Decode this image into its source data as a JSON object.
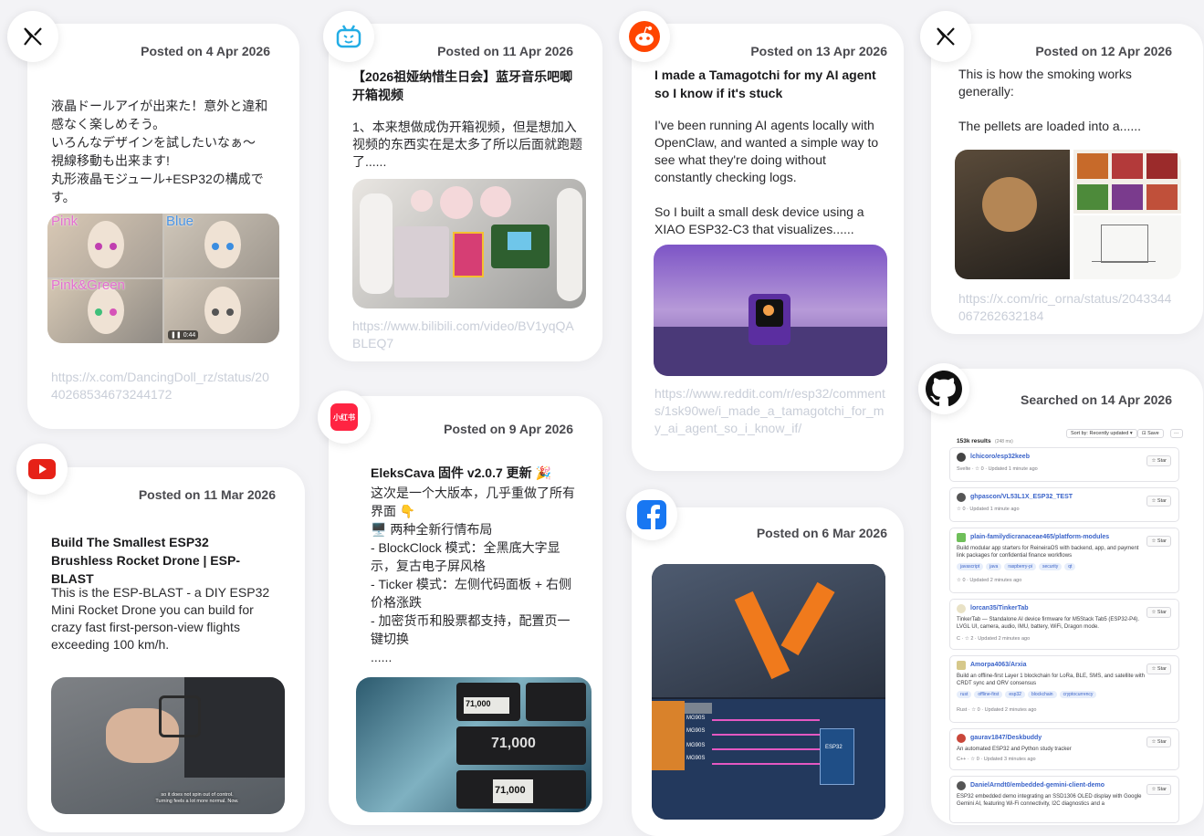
{
  "cards": [
    {
      "source": "x-icon",
      "posted": "Posted on 4 Apr 2026",
      "body": "液晶ドールアイが出来た！意外と違和\n感なく楽しめそう。\nいろんなデザインを試したいなぁ～\n視線移動も出来ます!\n丸形液晶モジュール+ESP32の構成で\nす。",
      "media_labels": [
        "Pink",
        "Blue",
        "Pink&Green"
      ],
      "media_duration": "0:44",
      "link": "https://x.com/DancingDoll_rz/status/2040268534673244172"
    },
    {
      "source": "youtube-icon",
      "posted": "Posted on 11 Mar 2026",
      "title": "Build The Smallest ESP32 Brushless Rocket Drone | ESP-BLAST",
      "body": "This is the ESP-BLAST - a DIY ESP32\nMini Rocket Drone you can build for\ncrazy fast first-person-view flights\nexceeding 100 km/h.",
      "media_caption": "so it does not spin out of control.\nTurning feels a lot more normal. Now."
    },
    {
      "source": "bilibili-icon",
      "posted": "Posted on 11 Apr 2026",
      "title": "【2026祖娅纳惜生日会】蓝牙音乐吧唧\n开箱视频",
      "body": "1、本来想做成伪开箱视频，但是想加入\n视频的东西实在是太多了所以后面就跑题\n了......",
      "link": "https://www.bilibili.com/video/BV1yqQABLEQ7"
    },
    {
      "source": "xiaohongshu-icon",
      "badge_text": "小红书",
      "posted": "Posted on 9 Apr 2026",
      "title": "EleksCava 固件 v2.0.7 更新 🎉",
      "body": "这次是一个大版本，几乎重做了所有\n界面 👇\n🖥️ 两种全新行情布局\n- BlockClock 模式：全黑底大字显\n示，复古电子屏风格\n- Ticker 模式：左侧代码面板 + 右侧\n价格涨跌\n- 加密货币和股票都支持，配置页一\n键切换\n......",
      "media_prices": [
        "71,000",
        "71,000",
        "71,000"
      ]
    },
    {
      "source": "reddit-icon",
      "posted": "Posted on 13 Apr 2026",
      "title": "I made a Tamagotchi for my AI agent\nso I know if it's stuck",
      "body": "I've been running AI agents locally with\nOpenClaw, and wanted a simple way to\nsee what they're doing without\nconstantly checking logs.\n\nSo I built a small desk device using a\nXIAO ESP32-C3 that visualizes......",
      "link": "https://www.reddit.com/r/esp32/comments/1sk90we/i_made_a_tamagotchi_for_my_ai_agent_so_i_know_if/"
    },
    {
      "source": "facebook-icon",
      "posted": "Posted on 6 Mar 2026",
      "media_labels": [
        "MG90S",
        "MG90S",
        "MG90S",
        "MG90S",
        "ESP32"
      ]
    },
    {
      "source": "x-icon",
      "posted": "Posted on 12 Apr 2026",
      "body": "This is how the smoking works\ngenerally:\n\nThe pellets are loaded into a......",
      "link": "https://x.com/ric_orna/status/2043344067262632184"
    },
    {
      "source": "github-icon",
      "posted": "Searched on 14 Apr 2026",
      "results_count": "153k results",
      "results_time": "(248 ms)",
      "sort_label": "Sort by: Recently updated",
      "save_label": "Save",
      "star_label": "Star",
      "repos": [
        {
          "name": "lchicoro/esp32keeb",
          "desc": "",
          "meta": "Svelte · ☆ 0 · Updated 1 minute ago",
          "tags": []
        },
        {
          "name": "ghpascon/VL53L1X_ESP32_TEST",
          "desc": "",
          "meta": "☆ 0 · Updated 1 minute ago",
          "tags": []
        },
        {
          "name": "plain-familydicranaceae465/platform-modules",
          "desc": "Build modular app starters for ReineiraOS with backend, app, and payment link packages for confidential finance workflows",
          "meta": "☆ 0 · Updated 2 minutes ago",
          "tags": [
            "javascript",
            "java",
            "raspberry-pi",
            "security",
            "qt"
          ]
        },
        {
          "name": "lorcan35/TinkerTab",
          "desc": "TinkerTab — Standalone AI device firmware for M5Stack Tab5 (ESP32-P4). LVGL UI, camera, audio, IMU, battery, WiFi, Dragon mode.",
          "meta": "C · ☆ 2 · Updated 2 minutes ago",
          "tags": []
        },
        {
          "name": "Amorpa4063/Arxia",
          "desc": "Build an offline-first Layer 1 blockchain for LoRa, BLE, SMS, and satellite with CRDT sync and ORV consensus",
          "meta": "Rust · ☆ 0 · Updated 2 minutes ago",
          "tags": [
            "rust",
            "offline-first",
            "esp32",
            "blockchain",
            "cryptocurrency"
          ]
        },
        {
          "name": "gaurav1847/Deskbuddy",
          "desc": "An automated ESP32 and Python study tracker",
          "meta": "C++ · ☆ 0 · Updated 3 minutes ago",
          "tags": []
        },
        {
          "name": "DanielArndt0/embedded-gemini-client-demo",
          "desc": "ESP32 embedded demo integrating an SSD1306 OLED display with Google Gemini AI, featuring Wi-Fi connectivity, I2C diagnostics and a",
          "meta": "",
          "tags": []
        }
      ]
    }
  ]
}
